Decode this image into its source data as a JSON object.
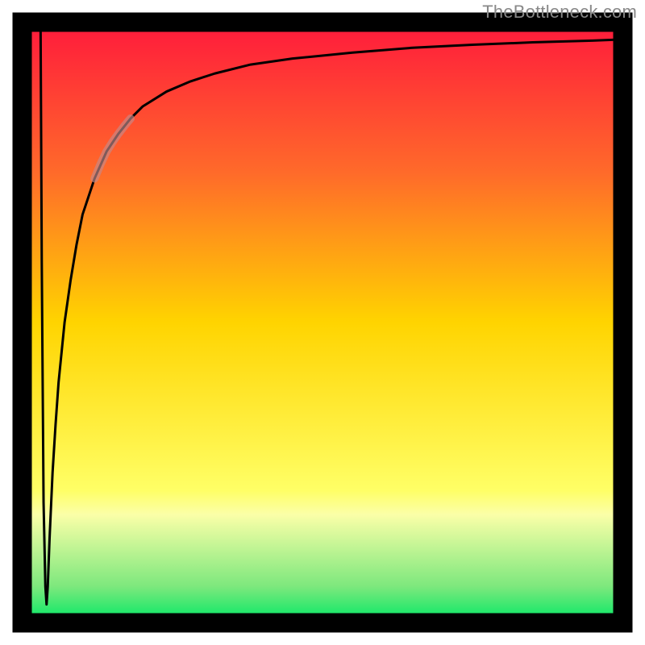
{
  "watermark": "TheBottleneck.com",
  "chart_data": {
    "type": "line",
    "title": "",
    "xlabel": "",
    "ylabel": "",
    "xlim": [
      0,
      100
    ],
    "ylim": [
      0,
      100
    ],
    "grid": false,
    "legend": null,
    "background_gradient_stops": [
      {
        "offset": 0.0,
        "color": "#ff1a3c"
      },
      {
        "offset": 0.25,
        "color": "#ff6a2a"
      },
      {
        "offset": 0.5,
        "color": "#ffd400"
      },
      {
        "offset": 0.78,
        "color": "#ffff66"
      },
      {
        "offset": 0.82,
        "color": "#fbffa8"
      },
      {
        "offset": 0.94,
        "color": "#7de87d"
      },
      {
        "offset": 1.0,
        "color": "#00e865"
      }
    ],
    "series": [
      {
        "name": "curve",
        "color": "#000000",
        "stroke_width": 3,
        "notes": "Sharp spike down near x≈4 reaching y≈3 (near green zone), then rapid rise asymptotically toward y≈97 as x→100.",
        "x": [
          3.0,
          3.2,
          3.5,
          3.8,
          4.0,
          4.2,
          4.5,
          5.0,
          5.5,
          6.0,
          7.0,
          8.0,
          9.0,
          10.0,
          12.0,
          14.0,
          16.0,
          18.0,
          20.0,
          24.0,
          28.0,
          32.0,
          38.0,
          45.0,
          55.0,
          65.0,
          75.0,
          85.0,
          95.0,
          100.0
        ],
        "values": [
          100.0,
          60.0,
          20.0,
          6.0,
          3.0,
          6.0,
          14.0,
          25.0,
          33.0,
          40.0,
          50.0,
          57.0,
          63.0,
          68.0,
          74.0,
          78.5,
          81.5,
          84.0,
          86.0,
          88.5,
          90.2,
          91.5,
          93.0,
          94.0,
          95.0,
          95.8,
          96.3,
          96.7,
          97.0,
          97.2
        ]
      },
      {
        "name": "highlight-segment",
        "color": "#c58a8a",
        "stroke_width": 10,
        "opacity": 0.65,
        "notes": "Short muted-rose overlay on the rising limb of the curve.",
        "x": [
          12.0,
          13.0,
          14.0,
          15.0,
          16.0,
          17.0,
          18.0
        ],
        "values": [
          74.0,
          76.4,
          78.5,
          80.1,
          81.5,
          82.8,
          84.0
        ]
      }
    ]
  }
}
